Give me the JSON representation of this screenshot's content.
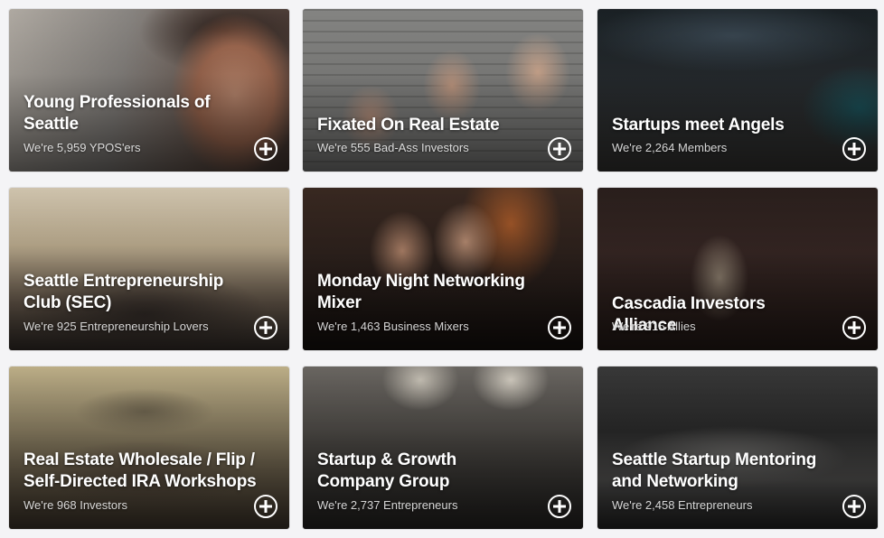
{
  "groups": [
    {
      "title": "Young Professionals of Seattle",
      "members": "We're 5,959 YPOS'ers",
      "action_icon": "plus-circle-icon"
    },
    {
      "title": "Fixated On Real Estate",
      "members": "We're 555 Bad-Ass Investors",
      "action_icon": "plus-circle-icon"
    },
    {
      "title": "Startups meet Angels",
      "members": "We're 2,264 Members",
      "action_icon": "plus-circle-icon"
    },
    {
      "title": "Seattle Entrepreneurship Club (SEC)",
      "members": "We're 925 Entrepreneurship Lovers",
      "action_icon": "plus-circle-icon"
    },
    {
      "title": "Monday Night Networking Mixer",
      "members": "We're 1,463 Business Mixers",
      "action_icon": "plus-circle-icon"
    },
    {
      "title": "Cascadia Investors Alliance",
      "members": "We're 915 Allies",
      "action_icon": "plus-circle-icon"
    },
    {
      "title": "Real Estate Wholesale / Flip / Self-Directed IRA Workshops",
      "members": "We're 968 Investors",
      "action_icon": "plus-circle-icon"
    },
    {
      "title": "Startup & Growth Company Group",
      "members": "We're 2,737 Entrepreneurs",
      "action_icon": "plus-circle-icon"
    },
    {
      "title": "Seattle Startup Mentoring and Networking",
      "members": "We're 2,458 Entrepreneurs",
      "action_icon": "plus-circle-icon"
    }
  ],
  "colors": {
    "page_background": "#f4f4f6",
    "text": "#ffffff"
  }
}
